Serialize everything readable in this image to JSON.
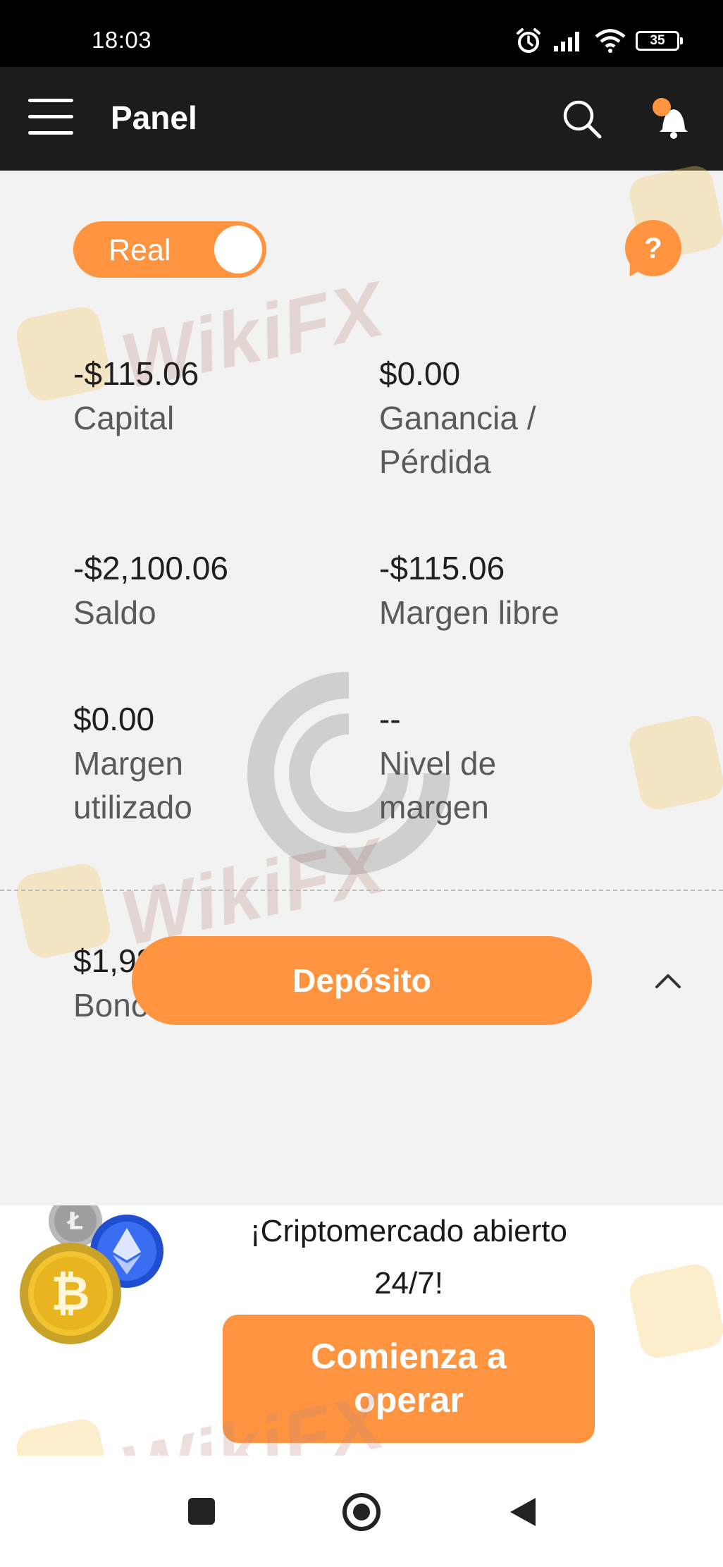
{
  "status_bar": {
    "time": "18:03",
    "battery": "35"
  },
  "header": {
    "title": "Panel"
  },
  "account_toggle": {
    "label": "Real",
    "state": "on"
  },
  "help_button": {
    "label": "?"
  },
  "metrics": [
    {
      "value": "-$115.06",
      "label": "Capital"
    },
    {
      "value": "$0.00",
      "label": "Ganancia / Pérdida"
    },
    {
      "value": "-$2,100.06",
      "label": "Saldo"
    },
    {
      "value": "-$115.06",
      "label": "Margen libre"
    },
    {
      "value": "$0.00",
      "label": "Margen utilizado"
    },
    {
      "value": "--",
      "label": "Nivel de margen"
    },
    {
      "value": "$1,985.00",
      "label": "Bono"
    }
  ],
  "deposit_button": {
    "label": "Depósito"
  },
  "promo": {
    "text_line1": "¡Criptomercado abierto",
    "text_line2": "24/7!",
    "button_line1": "Comienza a",
    "button_line2": "operar"
  },
  "watermark": {
    "text": "WikiFX"
  },
  "colors": {
    "accent": "#ff9440",
    "header_bg": "#1c1c1c",
    "content_bg": "#f2f2f2"
  },
  "icons": [
    "menu-icon",
    "search-icon",
    "bell-icon",
    "help-icon",
    "chevron-up-icon",
    "alarm-icon",
    "signal-icon",
    "wifi-icon",
    "battery-icon",
    "bitcoin-icon",
    "ethereum-icon",
    "litecoin-icon",
    "recent-apps-icon",
    "home-icon",
    "back-icon"
  ]
}
